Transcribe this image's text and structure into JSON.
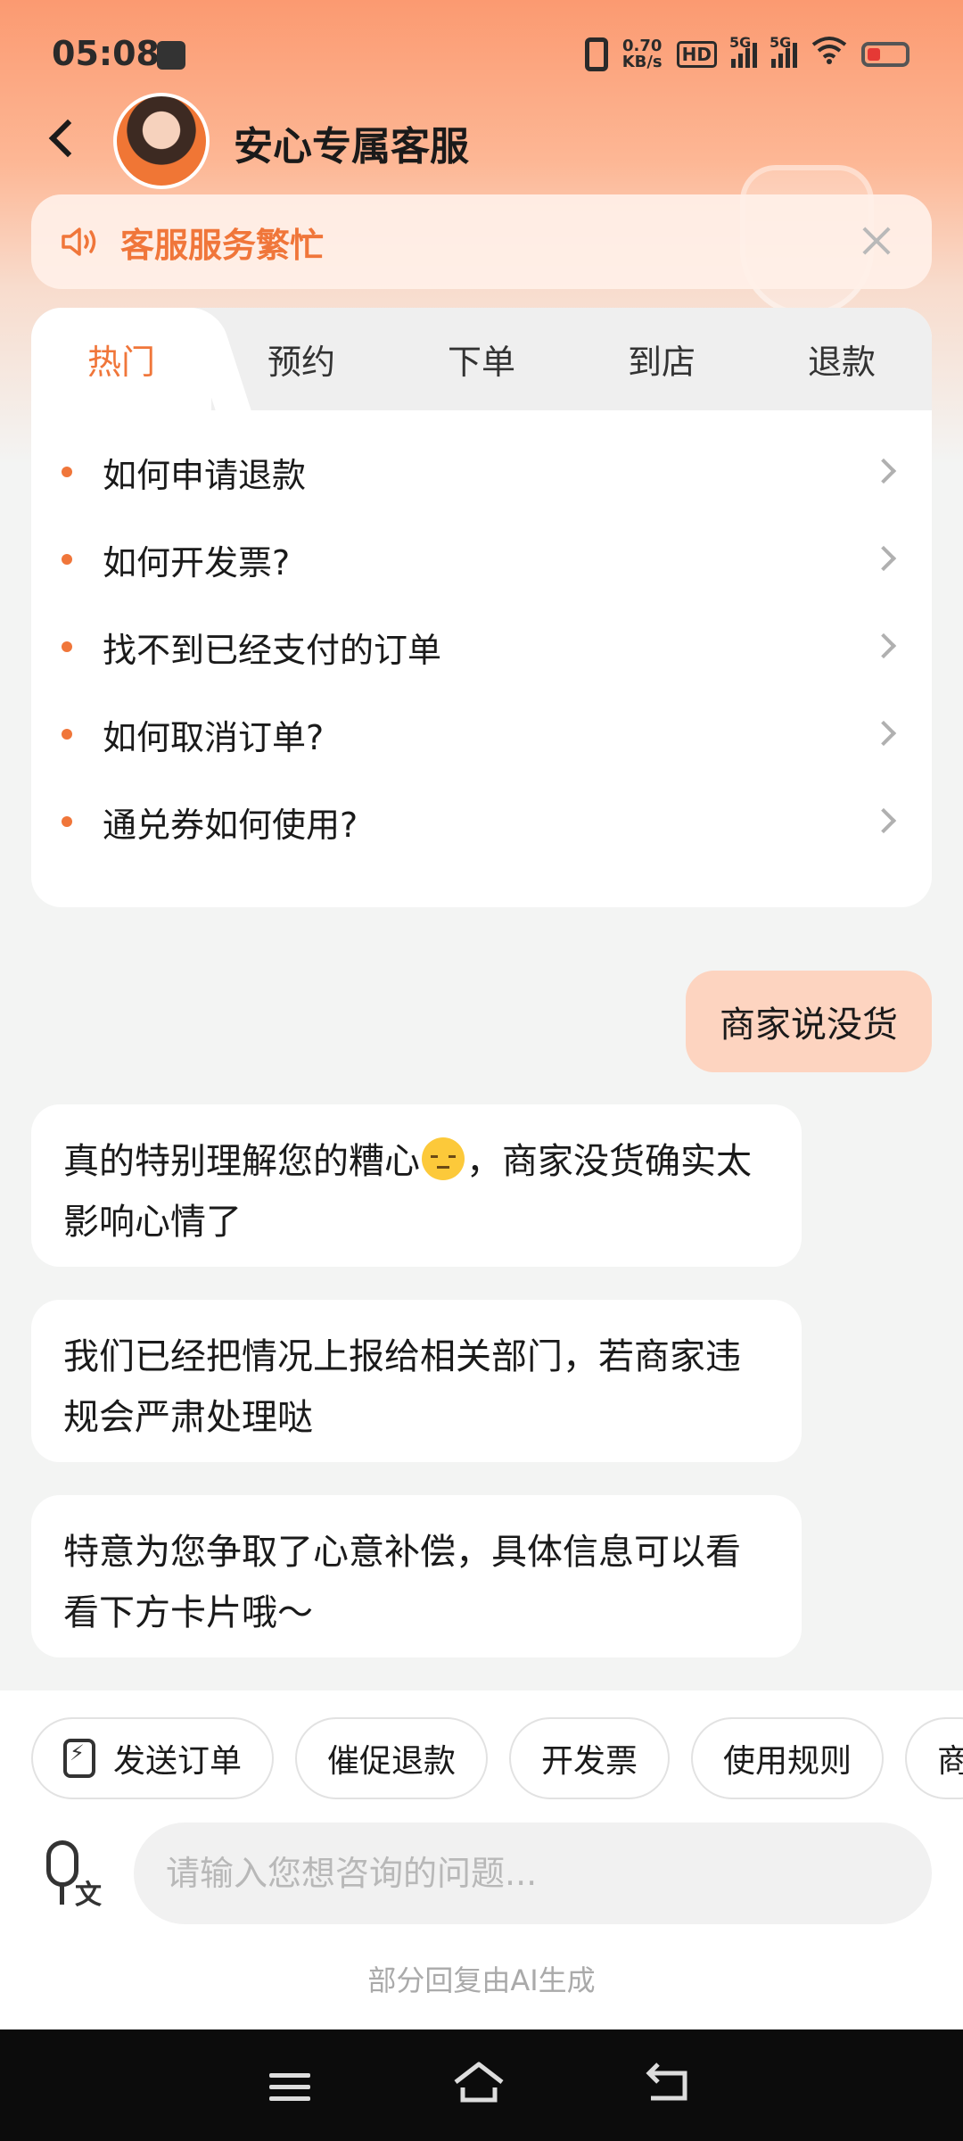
{
  "status_bar": {
    "time": "05:08",
    "speed_value": "0.70",
    "speed_unit": "KB/s",
    "hd_label": "HD",
    "net1": "5G",
    "net2": "5G"
  },
  "header": {
    "title": "安心专属客服"
  },
  "notice": {
    "text": "客服服务繁忙"
  },
  "faq": {
    "tabs": [
      {
        "label": "热门",
        "active": true
      },
      {
        "label": "预约",
        "active": false
      },
      {
        "label": "下单",
        "active": false
      },
      {
        "label": "到店",
        "active": false
      },
      {
        "label": "退款",
        "active": false
      }
    ],
    "items": [
      {
        "label": "如何申请退款"
      },
      {
        "label": "如何开发票?"
      },
      {
        "label": "找不到已经支付的订单"
      },
      {
        "label": "如何取消订单?"
      },
      {
        "label": "通兑券如何使用?"
      }
    ]
  },
  "chat": {
    "user_message": "商家说没货",
    "bot_messages": [
      {
        "before_emoji": "真的特别理解您的糟心",
        "after_emoji": "，商家没货确实太影响心情了"
      },
      {
        "text": "我们已经把情况上报给相关部门，若商家违规会严肃处理哒"
      },
      {
        "text": "特意为您争取了心意补偿，具体信息可以看看下方卡片哦～"
      }
    ]
  },
  "quick_actions": [
    {
      "label": "发送订单"
    },
    {
      "label": "催促退款"
    },
    {
      "label": "开发票"
    },
    {
      "label": "使用规则"
    },
    {
      "label": "商"
    }
  ],
  "composer": {
    "voice_label": "文",
    "placeholder": "请输入您想咨询的问题...",
    "ai_note": "部分回复由AI生成"
  },
  "colors": {
    "accent": "#f0763a",
    "user_bubble": "#fdd4c0",
    "nav_bar": "#0c0c0c"
  }
}
